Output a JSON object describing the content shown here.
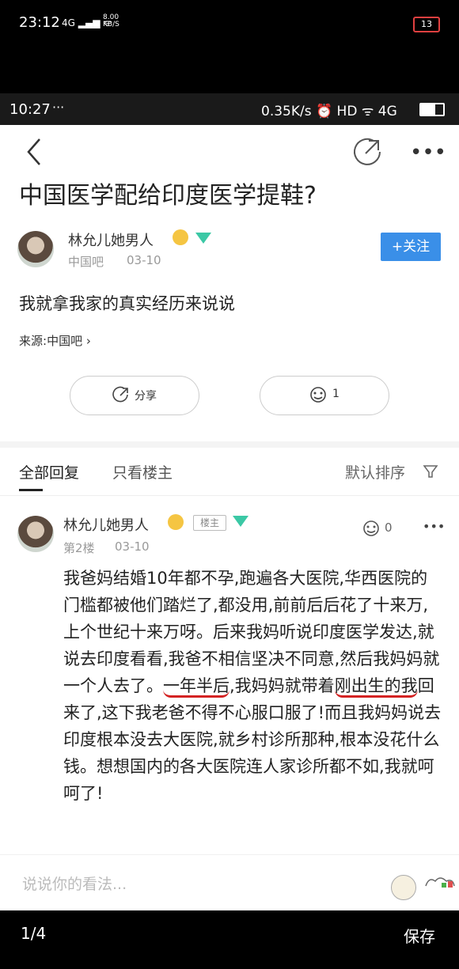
{
  "outer_status": {
    "time": "23:12",
    "signal": "4G",
    "speed_top": "8.00",
    "speed_unit": "KB/S",
    "battery": "13"
  },
  "inner_status": {
    "time": "10:27",
    "dots": "···",
    "right": "0.35K/s ⏰ HD ᯤ 4G"
  },
  "post": {
    "title": "中国医学配给印度医学提鞋?",
    "author": "林允儿她男人",
    "forum": "中国吧",
    "date": "03-10",
    "follow_label": "+关注",
    "text": "我就拿我家的真实经历来说说",
    "source_label": "来源:",
    "source_name": "中国吧",
    "share_label": "分享",
    "like_count": "1"
  },
  "tabs": {
    "all": "全部回复",
    "owner_only": "只看楼主",
    "sort": "默认排序"
  },
  "reply": {
    "author": "林允儿她男人",
    "badge": "楼主",
    "floor": "第2楼",
    "date": "03-10",
    "like_count": "0",
    "p1": "我爸妈结婚10年都不孕,跑遍各大医院,华西医院的门槛都被他们踏烂了,都没用,前前后后花了十来万,上个世纪十来万呀。后来我妈听说印度医学发达,就说去印度看看,我爸不相信坚决不同意,然后我妈妈就一个人去了。",
    "mark1": "一年半后",
    "p2": ",我妈妈就带着",
    "mark2": "刚出生的我",
    "p3": "回来了,这下我老爸不得不心服口服了!而且我妈妈说去印度根本没去大医院,就乡村诊所那种,根本没花什么钱。想想国内的各大医院连人家诊所都不如,我就呵呵了!"
  },
  "comment": {
    "placeholder": "说说你的看法..."
  },
  "viewer": {
    "pager": "1/4",
    "save": "保存"
  }
}
